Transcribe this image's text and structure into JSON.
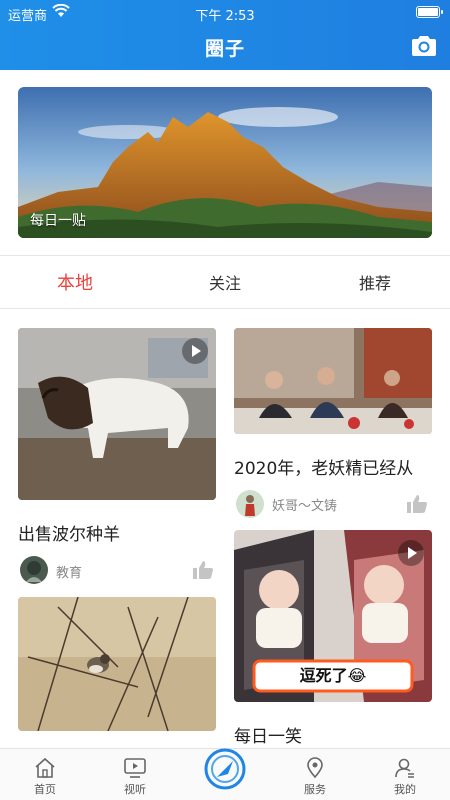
{
  "status": {
    "carrier": "运营商",
    "time": "下午 2:53"
  },
  "header": {
    "title": "圈子"
  },
  "banner": {
    "label": "每日一贴"
  },
  "tabs": [
    {
      "label": "本地",
      "active": true
    },
    {
      "label": "关注",
      "active": false
    },
    {
      "label": "推荐",
      "active": false
    }
  ],
  "posts": {
    "goat": {
      "title": "出售波尔种羊",
      "author": "教育"
    },
    "dinner": {
      "title": "2020年，老妖精已经从",
      "author": "妖哥～文铸"
    },
    "baby": {
      "title": "每日一笑",
      "caption": "逗死了😂"
    }
  },
  "bottom_nav": [
    {
      "label": "首页"
    },
    {
      "label": "视听"
    },
    {
      "label": ""
    },
    {
      "label": "服务"
    },
    {
      "label": "我的"
    }
  ],
  "colors": {
    "header": "#1f8fe8",
    "active_tab": "#e8423f"
  }
}
